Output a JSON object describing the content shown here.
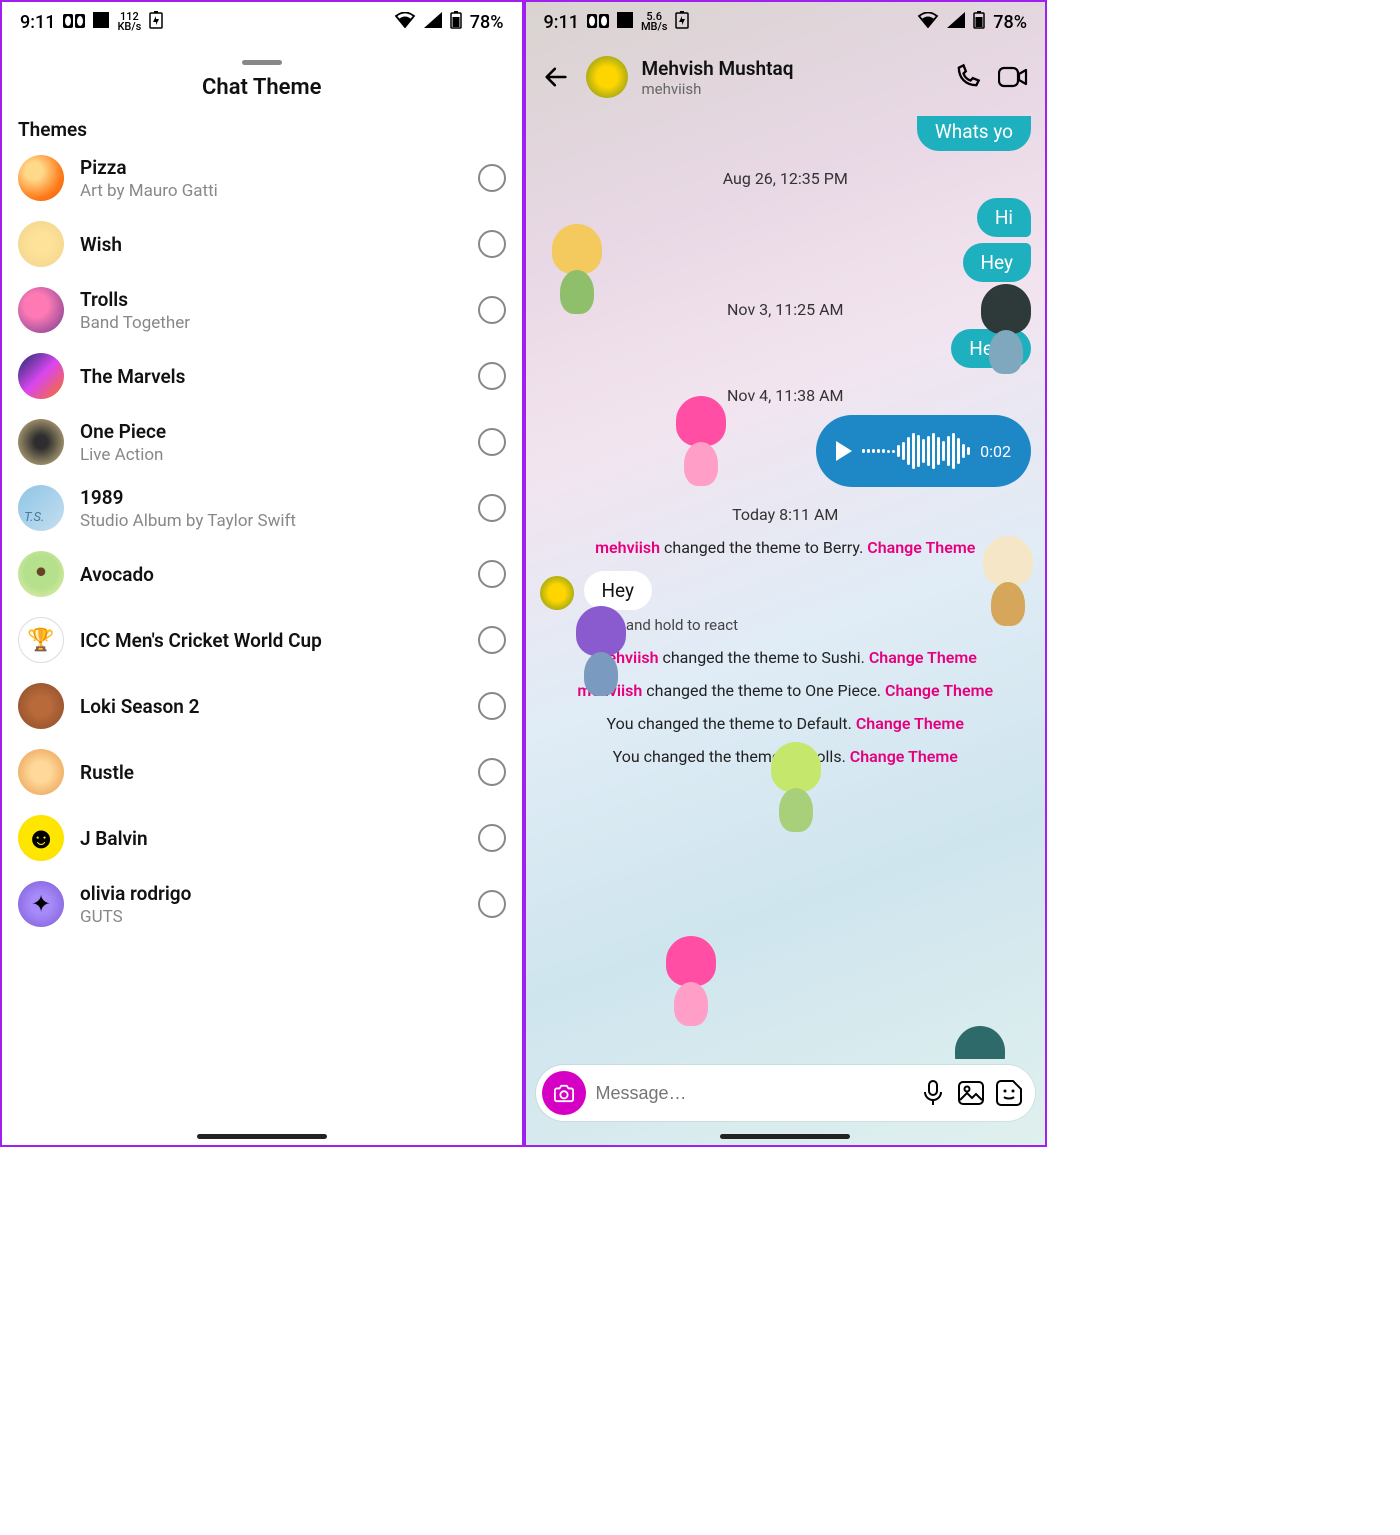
{
  "status": {
    "time": "9:11",
    "net_left": "112",
    "net_unit_left": "KB/s",
    "net_right": "5.6",
    "net_unit_right": "MB/s",
    "battery": "78%"
  },
  "left": {
    "title": "Chat Theme",
    "section": "Themes",
    "themes": [
      {
        "title": "Pizza",
        "sub": "Art by Mauro Gatti",
        "avatar": "av-pizza"
      },
      {
        "title": "Wish",
        "sub": "",
        "avatar": "av-wish"
      },
      {
        "title": "Trolls",
        "sub": "Band Together",
        "avatar": "av-trolls"
      },
      {
        "title": "The Marvels",
        "sub": "",
        "avatar": "av-marvels"
      },
      {
        "title": "One Piece",
        "sub": "Live Action",
        "avatar": "av-onepiece"
      },
      {
        "title": "1989",
        "sub": "Studio Album by Taylor Swift",
        "avatar": "av-1989"
      },
      {
        "title": "Avocado",
        "sub": "",
        "avatar": "av-avocado"
      },
      {
        "title": "ICC Men's Cricket World Cup",
        "sub": "",
        "avatar": "av-icc"
      },
      {
        "title": "Loki Season 2",
        "sub": "",
        "avatar": "av-loki"
      },
      {
        "title": "Rustle",
        "sub": "",
        "avatar": "av-rustle"
      },
      {
        "title": "J Balvin",
        "sub": "",
        "avatar": "av-jbalvin"
      },
      {
        "title": "olivia rodrigo",
        "sub": "GUTS",
        "avatar": "av-olivia"
      }
    ]
  },
  "right": {
    "name": "Mehvish Mushtaq",
    "username": "mehviish",
    "partial_top": "Whats yo",
    "ts1": "Aug 26, 12:35 PM",
    "msg_hi": "Hi",
    "msg_hey": "Hey",
    "ts2": "Nov 3, 11:25 AM",
    "msg_hello": "Hello",
    "ts3": "Nov 4, 11:38 AM",
    "voice_time": "0:02",
    "ts4": "Today 8:11 AM",
    "sys1_user": "mehviish",
    "sys1_text": " changed the theme to Berry. ",
    "change_link": "Change Theme",
    "incoming_hey": "Hey",
    "react_hint": "Tap and hold to react",
    "sys2_user": "mehviish",
    "sys2_text": " changed the theme to Sushi. ",
    "sys3_user": "mehviish",
    "sys3_text": " changed the theme to One Piece. ",
    "sys4_text": "You changed the theme to Default. ",
    "sys5_text": "You changed the theme to Trolls. ",
    "composer_placeholder": "Message…"
  }
}
